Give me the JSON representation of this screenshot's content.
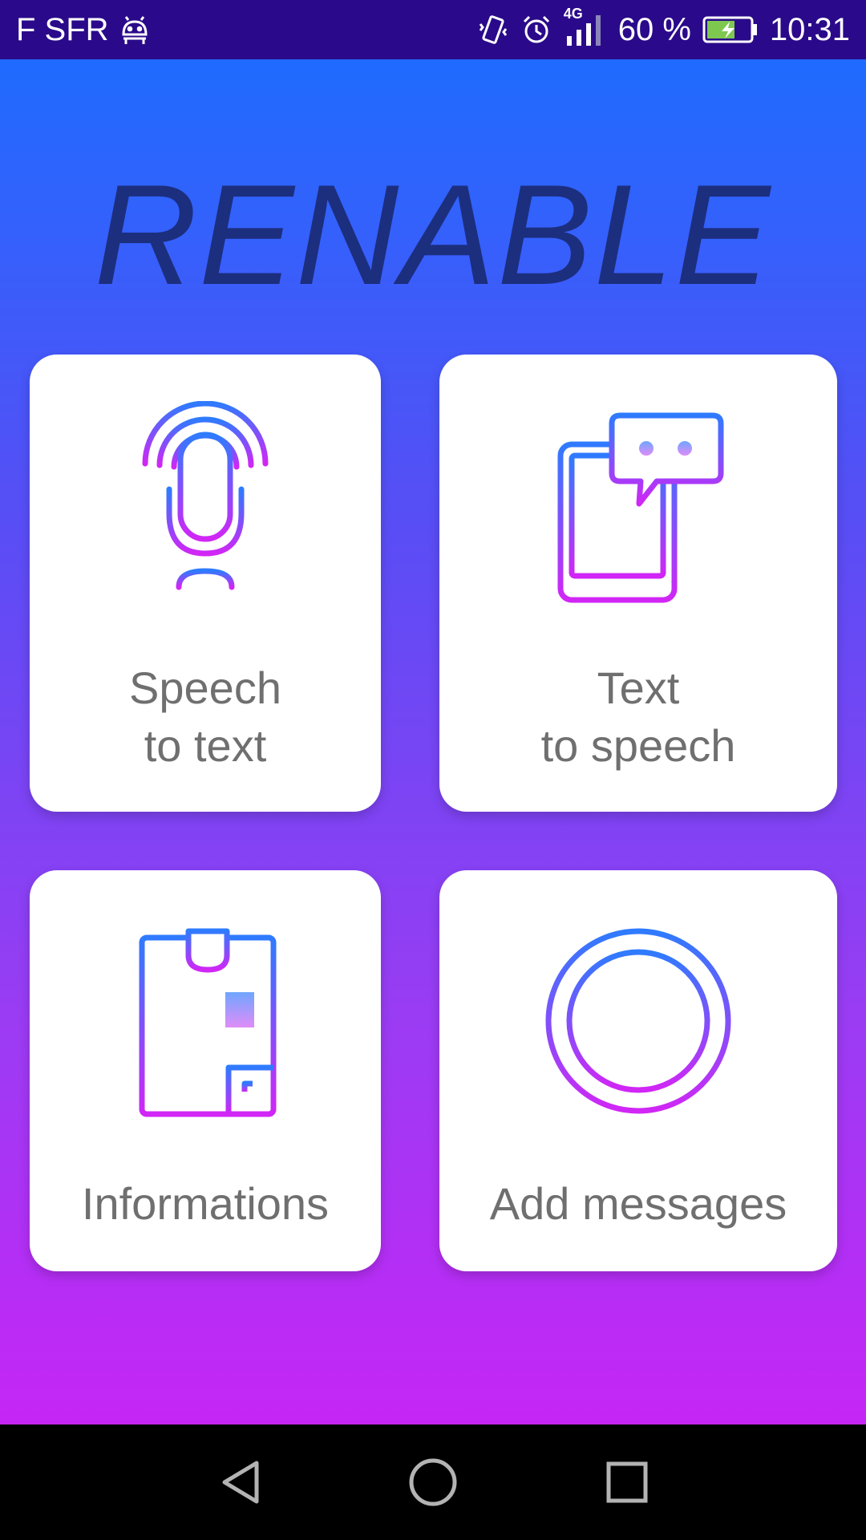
{
  "status_bar": {
    "carrier": "F SFR",
    "network": "4G",
    "battery": "60 %",
    "time": "10:31",
    "icons": [
      "android-debug-icon",
      "vibrate-icon",
      "alarm-icon",
      "signal-icon",
      "battery-charging-icon"
    ]
  },
  "app": {
    "title": "RENABLE"
  },
  "tiles": [
    {
      "line1": "Speech",
      "line2": "to text",
      "icon": "microphone-icon"
    },
    {
      "line1": "Text",
      "line2": "to speech",
      "icon": "phone-chat-icon"
    },
    {
      "line1": "Informations",
      "icon": "id-card-icon"
    },
    {
      "line1": "Add messages",
      "icon": "add-circle-icon"
    }
  ],
  "colors": {
    "gradient_top": "#1f6bff",
    "gradient_bottom": "#c526f6",
    "title": "#1c2e7e",
    "tile_text": "#6f6f6f",
    "icon_start": "#2f7bff",
    "icon_end": "#d126f5"
  },
  "nav_bar": {
    "icons": [
      "back-icon",
      "home-icon",
      "recents-icon"
    ]
  }
}
